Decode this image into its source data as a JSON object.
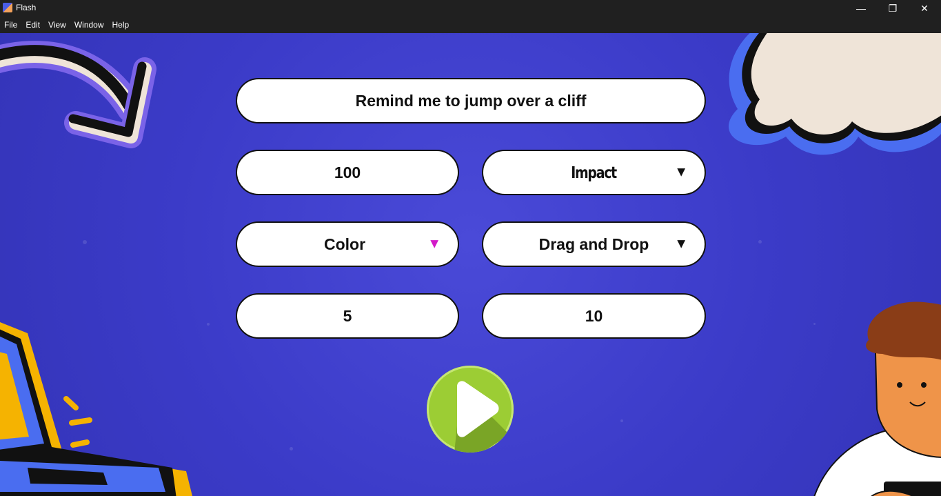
{
  "window": {
    "title": "Flash",
    "minimize_glyph": "—",
    "maximize_glyph": "❐",
    "close_glyph": "✕"
  },
  "menu": [
    "File",
    "Edit",
    "View",
    "Window",
    "Help"
  ],
  "form": {
    "message": "Remind me to jump over a cliff",
    "size_value": "100",
    "font_value": "Impact",
    "color_label": "Color",
    "animation_value": "Drag and Drop",
    "field_a_value": "5",
    "field_b_value": "10",
    "caret_glyph": "▼"
  },
  "icons": {
    "play": "play-icon",
    "dropdown": "caret-down-icon"
  },
  "colors": {
    "background": "#3b3bc8",
    "play_button": "#9ccd34",
    "color_caret": "#d21ac8",
    "titlebar": "#202020"
  }
}
